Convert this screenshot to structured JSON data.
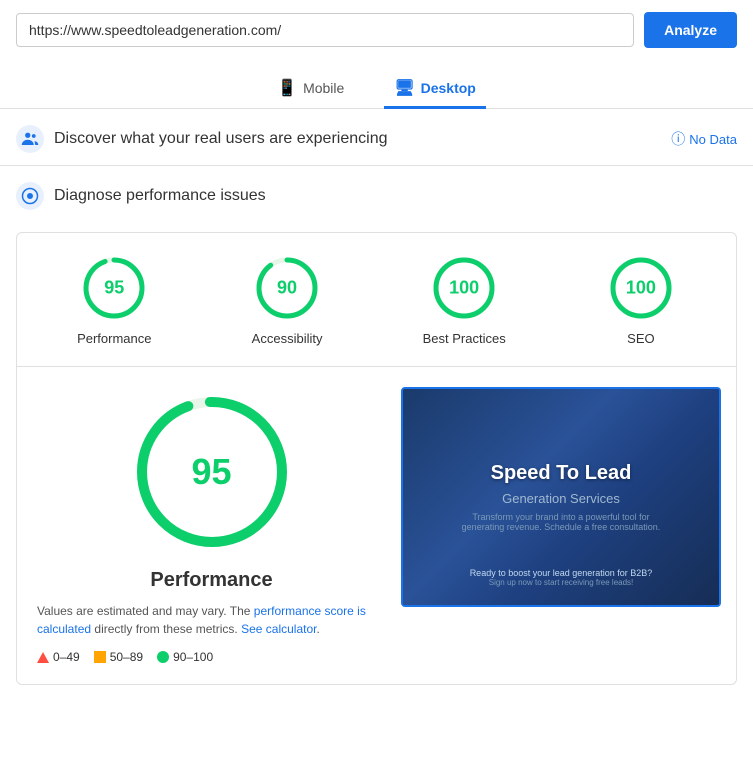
{
  "topbar": {
    "url": "https://www.speedtoleadgeneration.com/",
    "analyze_label": "Analyze"
  },
  "tabs": [
    {
      "id": "mobile",
      "label": "Mobile",
      "icon": "📱",
      "active": false
    },
    {
      "id": "desktop",
      "label": "Desktop",
      "icon": "🖥",
      "active": true
    }
  ],
  "real_users": {
    "title": "Discover what your real users are experiencing",
    "no_data_label": "No Data"
  },
  "diagnose": {
    "title": "Diagnose performance issues"
  },
  "scores": [
    {
      "id": "performance",
      "value": 95,
      "label": "Performance",
      "color": "#0cce6b",
      "radius": 28,
      "dash": 175.9,
      "gap": 9.3
    },
    {
      "id": "accessibility",
      "value": 90,
      "label": "Accessibility",
      "color": "#0cce6b",
      "radius": 28,
      "dash": 166.5,
      "gap": 18.7
    },
    {
      "id": "best-practices",
      "value": 100,
      "label": "Best Practices",
      "color": "#0cce6b",
      "radius": 28,
      "dash": 175.9,
      "gap": 0
    },
    {
      "id": "seo",
      "value": 100,
      "label": "SEO",
      "color": "#0cce6b",
      "radius": 28,
      "dash": 175.9,
      "gap": 0
    }
  ],
  "performance_detail": {
    "big_score": 95,
    "title": "Performance",
    "note_start": "Values are estimated and may vary. The",
    "note_link1": "performance score is calculated",
    "note_mid": "directly from these metrics.",
    "note_link2": "See calculator",
    "note_end": ".",
    "legend": [
      {
        "id": "fail",
        "type": "triangle",
        "range": "0–49"
      },
      {
        "id": "average",
        "type": "square",
        "range": "50–89"
      },
      {
        "id": "pass",
        "type": "dot",
        "color": "#0cce6b",
        "range": "90–100"
      }
    ]
  },
  "screenshot": {
    "title": "Speed To Lead",
    "subtitle": "Generation Services",
    "body": "Transform your brand into a powerful tool for generating revenue. Schedule a free consultation.",
    "cta": "Ready to boost your lead generation for B2B?",
    "cta_sub": "Sign up now to start receiving free leads!"
  }
}
